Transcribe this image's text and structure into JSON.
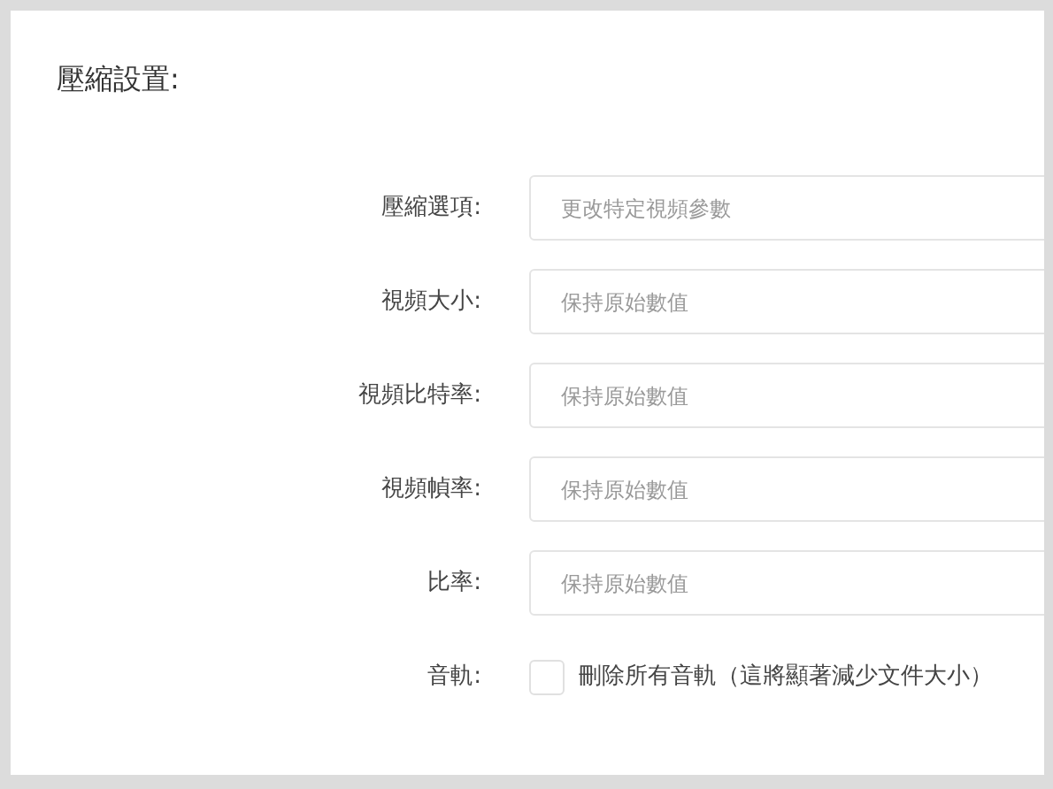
{
  "section": {
    "title": "壓縮設置:"
  },
  "fields": [
    {
      "kind": "text",
      "label": "壓縮選項:",
      "placeholder": "更改特定視頻參數"
    },
    {
      "kind": "text",
      "label": "視頻大小:",
      "placeholder": "保持原始數值"
    },
    {
      "kind": "text",
      "label": "視頻比特率:",
      "placeholder": "保持原始數值"
    },
    {
      "kind": "text",
      "label": "視頻幀率:",
      "placeholder": "保持原始數值"
    },
    {
      "kind": "text",
      "label": "比率:",
      "placeholder": "保持原始數值"
    },
    {
      "kind": "checkbox",
      "label": "音軌:",
      "text": "刪除所有音軌（這將顯著減少文件大小）",
      "checked": false
    }
  ]
}
